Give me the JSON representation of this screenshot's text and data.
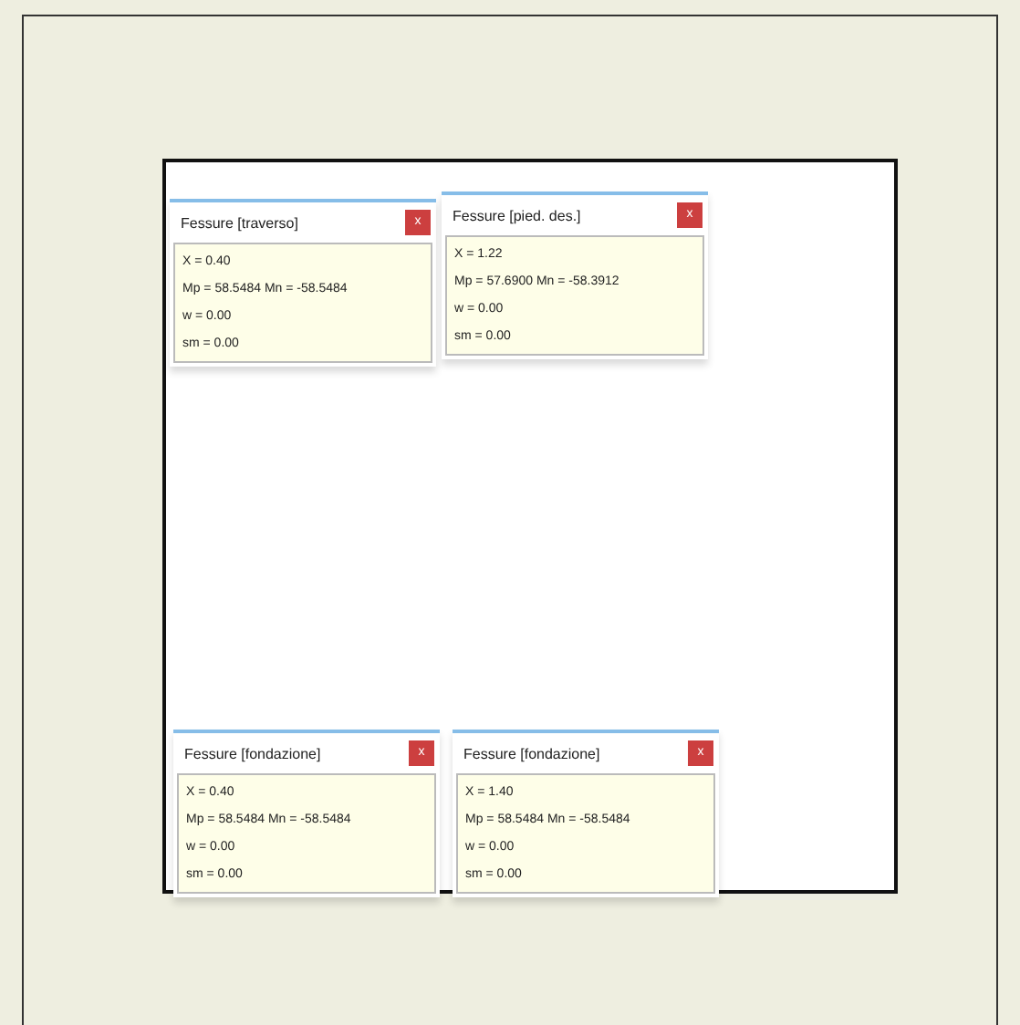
{
  "panels": [
    {
      "title": "Fessure  [traverso]",
      "close": "x",
      "x_line": "X  = 0.40",
      "moments": "Mp = 58.5484  Mn = -58.5484",
      "w_line": "w  = 0.00",
      "sm_line": "sm = 0.00"
    },
    {
      "title": "Fessure  [pied. des.]",
      "close": "x",
      "x_line": "X  = 1.22",
      "moments": "Mp = 57.6900  Mn = -58.3912",
      "w_line": "w  = 0.00",
      "sm_line": "sm = 0.00"
    },
    {
      "title": "Fessure  [fondazione]",
      "close": "x",
      "x_line": "X  = 0.40",
      "moments": "Mp = 58.5484  Mn = -58.5484",
      "w_line": "w  = 0.00",
      "sm_line": "sm = 0.00"
    },
    {
      "title": "Fessure  [fondazione]",
      "close": "x",
      "x_line": "X  = 1.40",
      "moments": "Mp = 58.5484  Mn = -58.5484",
      "w_line": "w  = 0.00",
      "sm_line": "sm = 0.00"
    }
  ]
}
